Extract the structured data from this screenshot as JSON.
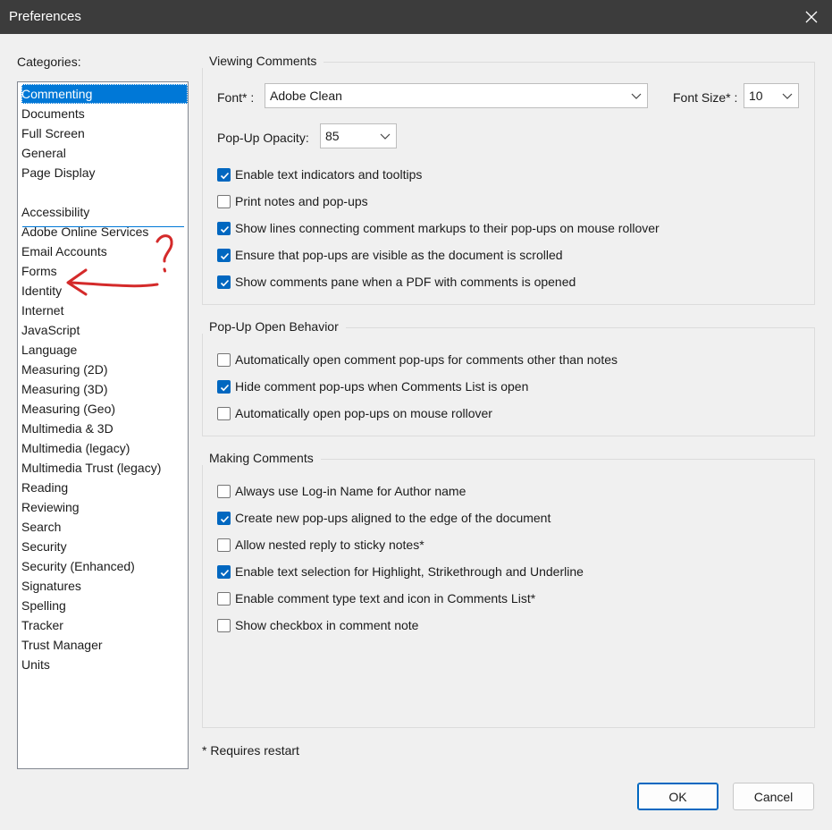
{
  "window": {
    "title": "Preferences"
  },
  "categories": {
    "label": "Categories:",
    "top_items": [
      {
        "label": "Commenting",
        "selected": true
      },
      {
        "label": "Documents"
      },
      {
        "label": "Full Screen"
      },
      {
        "label": "General"
      },
      {
        "label": "Page Display"
      }
    ],
    "items": [
      "Accessibility",
      "Adobe Online Services",
      "Email Accounts",
      "Forms",
      "Identity",
      "Internet",
      "JavaScript",
      "Language",
      "Measuring (2D)",
      "Measuring (3D)",
      "Measuring (Geo)",
      "Multimedia & 3D",
      "Multimedia (legacy)",
      "Multimedia Trust (legacy)",
      "Reading",
      "Reviewing",
      "Search",
      "Security",
      "Security (Enhanced)",
      "Signatures",
      "Spelling",
      "Tracker",
      "Trust Manager",
      "Units"
    ]
  },
  "viewing_comments": {
    "title": "Viewing Comments",
    "font_label": "Font* :",
    "font_value": "Adobe Clean",
    "font_size_label": "Font Size* :",
    "font_size_value": "10",
    "opacity_label": "Pop-Up Opacity:",
    "opacity_value": "85",
    "checkboxes": [
      {
        "label": "Enable text indicators and tooltips",
        "checked": true
      },
      {
        "label": "Print notes and pop-ups",
        "checked": false
      },
      {
        "label": "Show lines connecting comment markups to their pop-ups on mouse rollover",
        "checked": true
      },
      {
        "label": "Ensure that pop-ups are visible as the document is scrolled",
        "checked": true
      },
      {
        "label": "Show comments pane when a PDF with comments is opened",
        "checked": true
      }
    ]
  },
  "popup_open_behavior": {
    "title": "Pop-Up Open Behavior",
    "checkboxes": [
      {
        "label": "Automatically open comment pop-ups for comments other than notes",
        "checked": false
      },
      {
        "label": "Hide comment pop-ups when Comments List is open",
        "checked": true
      },
      {
        "label": "Automatically open pop-ups on mouse rollover",
        "checked": false
      }
    ]
  },
  "making_comments": {
    "title": "Making Comments",
    "checkboxes": [
      {
        "label": "Always use Log-in Name for Author name",
        "checked": false
      },
      {
        "label": "Create new pop-ups aligned to the edge of the document",
        "checked": true
      },
      {
        "label": "Allow nested reply to sticky notes*",
        "checked": false
      },
      {
        "label": "Enable text selection for Highlight, Strikethrough and Underline",
        "checked": true
      },
      {
        "label": "Enable comment type text and icon in Comments List*",
        "checked": false
      },
      {
        "label": "Show checkbox in comment note",
        "checked": false
      }
    ]
  },
  "footnote": "* Requires restart",
  "buttons": {
    "ok": "OK",
    "cancel": "Cancel"
  },
  "colors": {
    "accent": "#0078d7",
    "checkbox": "#0067c0",
    "annotation": "#d42a2a"
  },
  "icons": [
    "close-icon",
    "chevron-down-icon",
    "checkmark-icon"
  ]
}
